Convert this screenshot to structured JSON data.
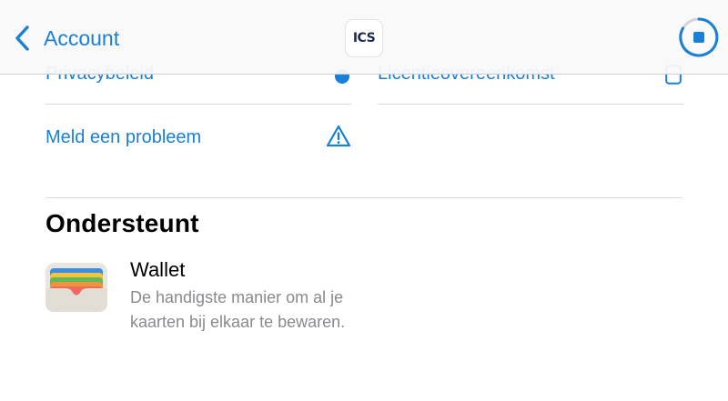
{
  "navbar": {
    "back_label": "Account",
    "logo_text": "ICS",
    "accent_color": "#1a7fd6"
  },
  "links": {
    "privacy_label": "Privacybeleid",
    "license_label": "Licentieovereenkomst",
    "report_label": "Meld een probleem"
  },
  "supports": {
    "title": "Ondersteunt",
    "wallet_title": "Wallet",
    "wallet_desc": "De handigste manier om al je kaarten bij elkaar te bewaren."
  },
  "icons": {
    "back": "chevron-left-icon",
    "stop": "stop-progress-icon",
    "privacy": "privacy-hand-icon",
    "license": "document-icon",
    "report": "warning-triangle-icon",
    "wallet": "wallet-app-icon"
  }
}
